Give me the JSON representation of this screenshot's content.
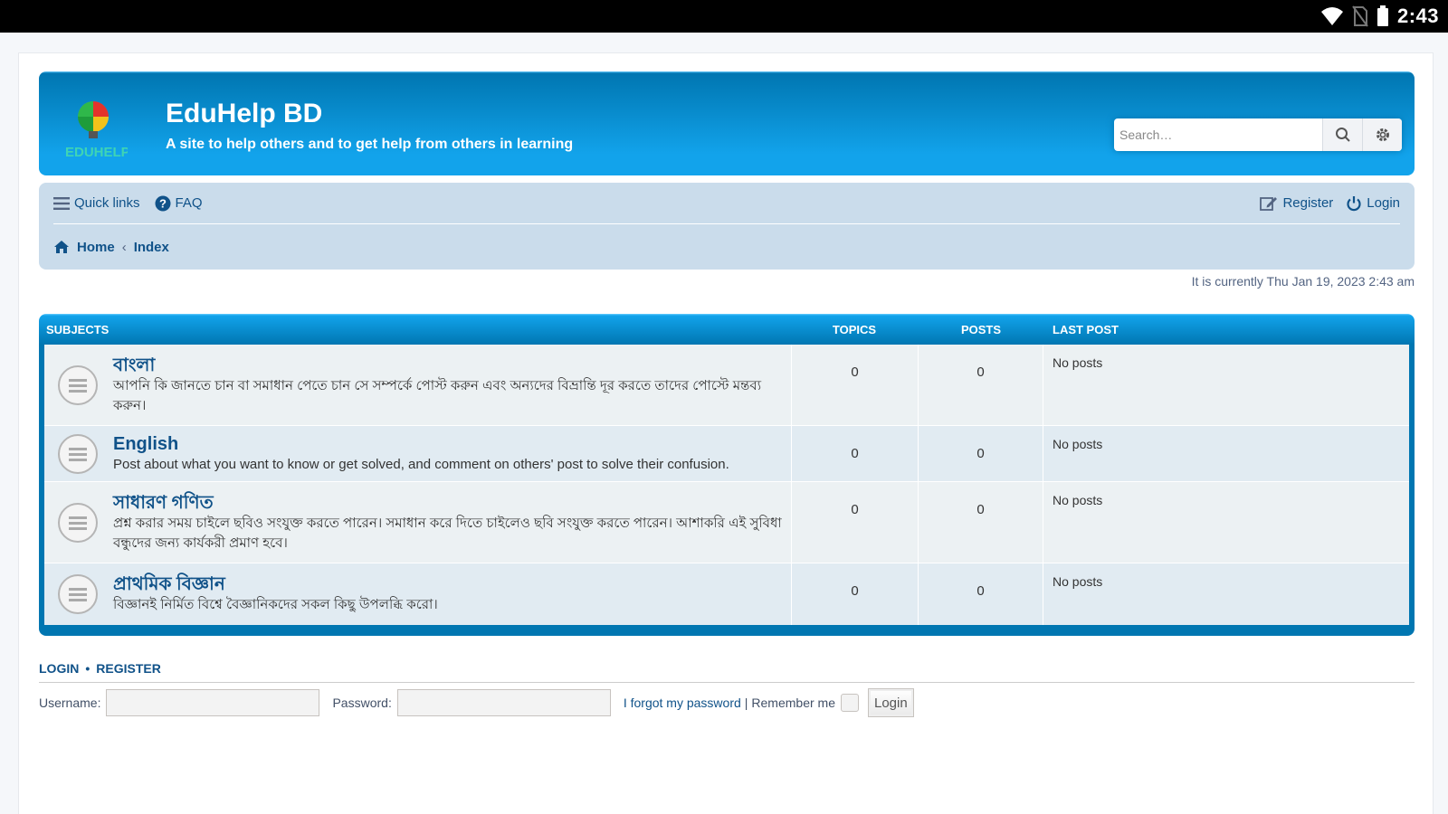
{
  "status_bar": {
    "time": "2:43"
  },
  "header": {
    "site_title": "EduHelp BD",
    "site_description": "A site to help others and to get help from others in learning",
    "search_placeholder": "Search…",
    "logo_text": "EDUHELP"
  },
  "navbar": {
    "quick_links": "Quick links",
    "faq": "FAQ",
    "register": "Register",
    "login": "Login",
    "breadcrumbs": [
      "Home",
      "Index"
    ]
  },
  "current_time": "It is currently Thu Jan 19, 2023 2:43 am",
  "forum_table": {
    "headers": {
      "subjects": "Subjects",
      "topics": "Topics",
      "posts": "Posts",
      "last_post": "Last post"
    },
    "rows": [
      {
        "title": "বাংলা",
        "description": "আপনি কি জানতে চান বা সমাধান পেতে চান সে সম্পর্কে পোস্ট করুন এবং অন্যদের বিভ্রান্তি দূর করতে তাদের পোস্টে মন্তব্য করুন।",
        "topics": "0",
        "posts": "0",
        "last_post": "No posts"
      },
      {
        "title": "English",
        "description": "Post about what you want to know or get solved, and comment on others' post to solve their confusion.",
        "topics": "0",
        "posts": "0",
        "last_post": "No posts"
      },
      {
        "title": "সাধারণ গণিত",
        "description": "প্রশ্ন করার সময় চাইলে ছবিও সংযুক্ত করতে পারেন। সমাধান করে দিতে চাইলেও ছবি সংযুক্ত করতে পারেন। আশাকরি এই সুবিধা বন্ধুদের জন্য কার্যকরী প্রমাণ হবে।",
        "topics": "0",
        "posts": "0",
        "last_post": "No posts"
      },
      {
        "title": "প্রাথমিক বিজ্ঞান",
        "description": "বিজ্ঞানই নির্মিত বিশ্বে বৈজ্ঞানিকদের সকল কিছু উপলব্ধি করো।",
        "topics": "0",
        "posts": "0",
        "last_post": "No posts"
      }
    ]
  },
  "login_panel": {
    "login_label": "Login",
    "register_label": "Register",
    "username_label": "Username:",
    "password_label": "Password:",
    "forgot_password": "I forgot my password",
    "separator": "|",
    "remember_me": "Remember me",
    "login_button": "Login"
  },
  "colors": {
    "header_blue": "#12a3eb",
    "navbar_bg": "#cadceb",
    "link_blue": "#105289",
    "table_blue": "#0076b1"
  }
}
